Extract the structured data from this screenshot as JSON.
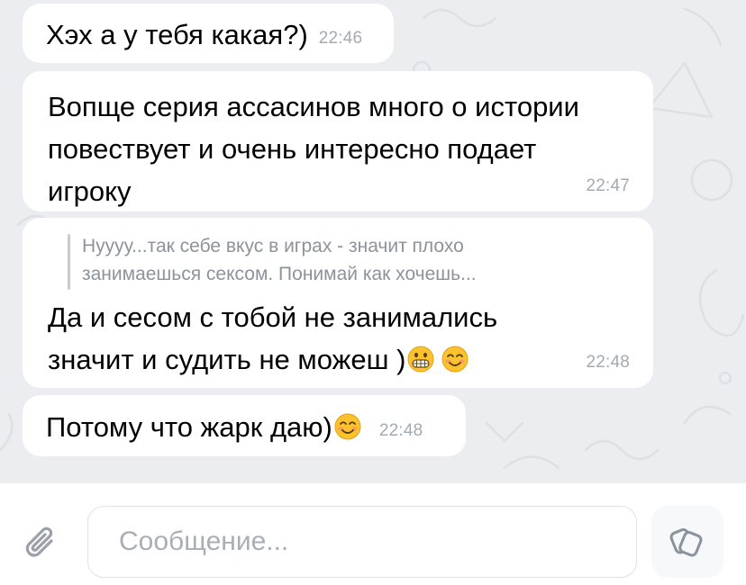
{
  "messages": [
    {
      "text": "Хэх а у тебя какая?)",
      "time": "22:46"
    },
    {
      "text": "Вопще серия ассасинов много о истории\nповествует и очень интересно подает\nигроку",
      "time": "22:47"
    },
    {
      "reply_to": "Нуууу...так себе вкус в играх - значит плохо\nзанимаешься сексом. Понимай как хочешь...",
      "text_line1": "Да и сесом с тобой не занимались",
      "text_line2": "значит и судить не можеш )",
      "emojis": [
        "grimacing-face",
        "smiling-face-with-smiling-eyes"
      ],
      "time": "22:48"
    },
    {
      "text": "Потому что жарк даю)",
      "emojis": [
        "smiling-face-with-smiling-eyes"
      ],
      "time": "22:48"
    }
  ],
  "composer": {
    "placeholder": "Сообщение...",
    "value": "",
    "attach_icon": "paperclip-icon",
    "sticker_icon": "sticker-icon"
  },
  "colors": {
    "chat_background": "#ebedf0",
    "bubble": "#ffffff",
    "timestamp": "#a3aab3",
    "reply_bar": "#c7ccd3",
    "reply_text": "#8c939c"
  }
}
